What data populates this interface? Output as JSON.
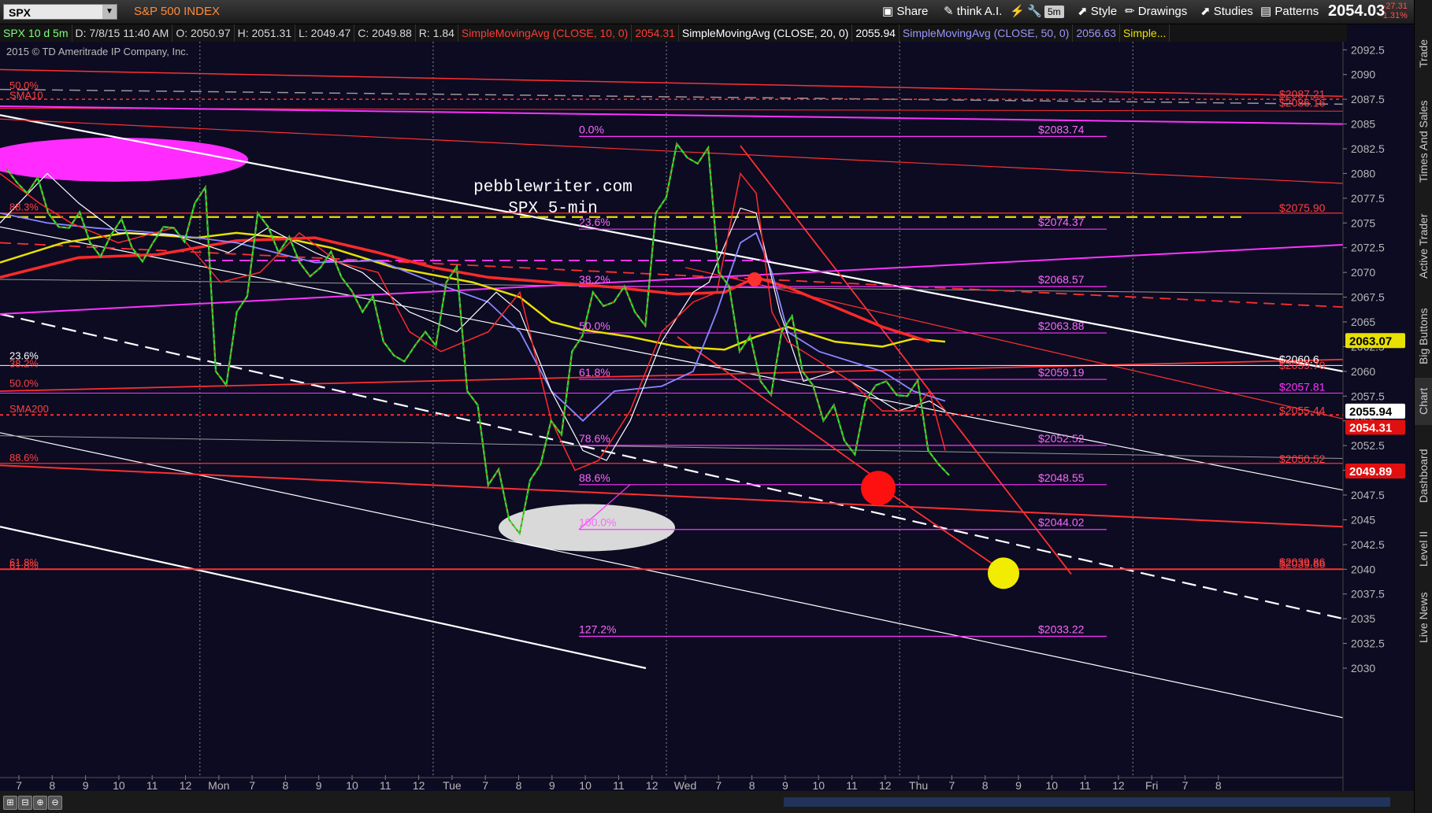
{
  "toolbar": {
    "symbol": "SPX",
    "symbol_description": "S&P 500 INDEX",
    "buttons": [
      "Share",
      "think A.I.",
      "5m",
      "Style",
      "Drawings",
      "Studies",
      "Patterns"
    ],
    "last_price": "2054.03",
    "net_change": "-27.31",
    "net_change_pct": "-1.31%",
    "accent_color": "#ff8a3a",
    "down_color": "#ff5050"
  },
  "infobar": {
    "study_title": "SPX 10 d 5m",
    "date": "D: 7/8/15 11:40 AM",
    "open": "O: 2050.97",
    "high": "H: 2051.31",
    "low": "L: 2049.47",
    "close": "C: 2049.88",
    "range": "R: 1.84",
    "sma10_label": "SimpleMovingAvg (CLOSE, 10, 0)",
    "sma10_value": "2054.31",
    "sma20_label": "SimpleMovingAvg (CLOSE, 20, 0)",
    "sma20_value": "2055.94",
    "sma50_label": "SimpleMovingAvg (CLOSE, 50, 0)",
    "sma50_value": "2056.63",
    "more": "Simple..."
  },
  "copyright": "2015 © TD Ameritrade IP Company, Inc.",
  "watermark": {
    "line1": "pebblewriter.com",
    "line2": "SPX 5-min"
  },
  "right_tabs": [
    "Trade",
    "Times And Sales",
    "Active Trader",
    "Big Buttons",
    "Chart",
    "Dashboard",
    "Level II",
    "Live News"
  ],
  "bottom_buttons": [
    "⊞",
    "⊟",
    "⊕",
    "⊖"
  ],
  "chart_data": {
    "type": "line",
    "title": "SPX 5-min",
    "ylim": [
      2030,
      2093
    ],
    "y_ticks": [
      "2092.5",
      "2090",
      "2087.5",
      "2085",
      "2082.5",
      "2080",
      "2077.5",
      "2075",
      "2072.5",
      "2070",
      "2067.5",
      "2065",
      "2062.5",
      "2060",
      "2057.5",
      "2055",
      "2052.5",
      "2050",
      "2047.5",
      "2045",
      "2042.5",
      "2040",
      "2037.5",
      "2035",
      "2032.5",
      "2030"
    ],
    "x_ticks": [
      "7",
      "8",
      "9",
      "10",
      "11",
      "12",
      "Mon",
      "7",
      "8",
      "9",
      "10",
      "11",
      "12",
      "Tue",
      "7",
      "8",
      "9",
      "10",
      "11",
      "12",
      "Wed",
      "7",
      "8",
      "9",
      "10",
      "11",
      "12",
      "Thu",
      "7",
      "8",
      "9",
      "10",
      "11",
      "12",
      "Fri",
      "7",
      "8"
    ],
    "price_path": [
      2080.5,
      2078,
      2076,
      2074.5,
      2073,
      2073.8,
      2072.5,
      2073,
      2074.5,
      2077,
      2060,
      2066,
      2076,
      2072,
      2071,
      2070.5,
      2069.5,
      2066,
      2063,
      2061,
      2064,
      2069,
      2058,
      2048.5,
      2045,
      2049,
      2055,
      2062,
      2068,
      2067,
      2066,
      2076,
      2083,
      2081,
      2070,
      2062,
      2059,
      2064,
      2060,
      2055,
      2053,
      2057,
      2059,
      2057.5,
      2052,
      2049.5
    ],
    "series": [
      {
        "name": "SimpleMovingAvg (CLOSE, 10, 0)",
        "value": 2054.31,
        "color": "#ff2a2a"
      },
      {
        "name": "SimpleMovingAvg (CLOSE, 20, 0)",
        "value": 2055.94,
        "color": "#ffffff"
      },
      {
        "name": "SimpleMovingAvg (CLOSE, 50, 0)",
        "value": 2056.63,
        "color": "#8b86ff"
      },
      {
        "name": "SMA200",
        "value": 2063.07,
        "color": "#e8e000"
      }
    ],
    "fib_levels": [
      {
        "label": "0.0%",
        "value": 2083.74,
        "price_label": "$2083.74"
      },
      {
        "label": "23.6%",
        "value": 2074.37,
        "price_label": "$2074.37"
      },
      {
        "label": "38.2%",
        "value": 2068.57,
        "price_label": "$2068.57"
      },
      {
        "label": "50.0%",
        "value": 2063.88,
        "price_label": "$2063.88"
      },
      {
        "label": "61.8%",
        "value": 2059.19,
        "price_label": "$2059.19"
      },
      {
        "label": "78.6%",
        "value": 2052.52,
        "price_label": "$2052.52"
      },
      {
        "label": "88.6%",
        "value": 2048.55,
        "price_label": "$2048.55"
      },
      {
        "label": "100.0%",
        "value": 2044.02,
        "price_label": "$2044.02"
      },
      {
        "label": "127.2%",
        "value": 2033.22,
        "price_label": "$2033.22"
      }
    ],
    "left_labels": [
      {
        "label": "50.0%",
        "value": 2088.3,
        "color": "#ff4040"
      },
      {
        "label": "SMA10",
        "value": 2087.3,
        "color": "#ff4040"
      },
      {
        "label": "88.3%",
        "value": 2076.0,
        "color": "#ff4040"
      },
      {
        "label": "23.6%",
        "value": 2061.0,
        "color": "#ffffff"
      },
      {
        "label": "38.2%",
        "value": 2060.2,
        "color": "#ff4040"
      },
      {
        "label": "50.0%",
        "value": 2058.2,
        "color": "#ff4040"
      },
      {
        "label": "SMA200",
        "value": 2055.6,
        "color": "#ff4040"
      },
      {
        "label": "88.6%",
        "value": 2050.7,
        "color": "#ff4040"
      },
      {
        "label": "61.8%",
        "value": 2039.8,
        "color": "#ff4040"
      },
      {
        "label": "61.8%",
        "value": 2040.1,
        "color": "#ff4040"
      }
    ],
    "right_labels": [
      {
        "label": "$2087.21",
        "value": 2087.4,
        "color": "#ff4040"
      },
      {
        "label": "$2086.16",
        "value": 2086.5,
        "color": "#ff4040"
      },
      {
        "label": "$2075.90",
        "value": 2075.9,
        "color": "#ff4040"
      },
      {
        "label": "$2060.6",
        "value": 2060.6,
        "color": "#ffffff"
      },
      {
        "label": "$2059.70",
        "value": 2060.0,
        "color": "#ff4040"
      },
      {
        "label": "$2057.81",
        "value": 2057.81,
        "color": "#ff33ff"
      },
      {
        "label": "$2055.44",
        "value": 2055.4,
        "color": "#ff4040"
      },
      {
        "label": "$2050.52",
        "value": 2050.52,
        "color": "#ff4040"
      },
      {
        "label": "$2039.86",
        "value": 2040.1,
        "color": "#ff4040"
      },
      {
        "label": "$2039.66",
        "value": 2039.9,
        "color": "#ff4040"
      }
    ],
    "axis_price_tags": [
      {
        "label": "2063.07",
        "value": 2063.07,
        "bg": "#e8e000",
        "fg": "#000000"
      },
      {
        "label": "2055.94",
        "value": 2055.94,
        "bg": "#ffffff",
        "fg": "#000000"
      },
      {
        "label": "2054.31",
        "value": 2054.31,
        "bg": "#e01010",
        "fg": "#ffffff"
      },
      {
        "label": "2049.89",
        "value": 2049.89,
        "bg": "#e01010",
        "fg": "#ffffff"
      }
    ]
  }
}
